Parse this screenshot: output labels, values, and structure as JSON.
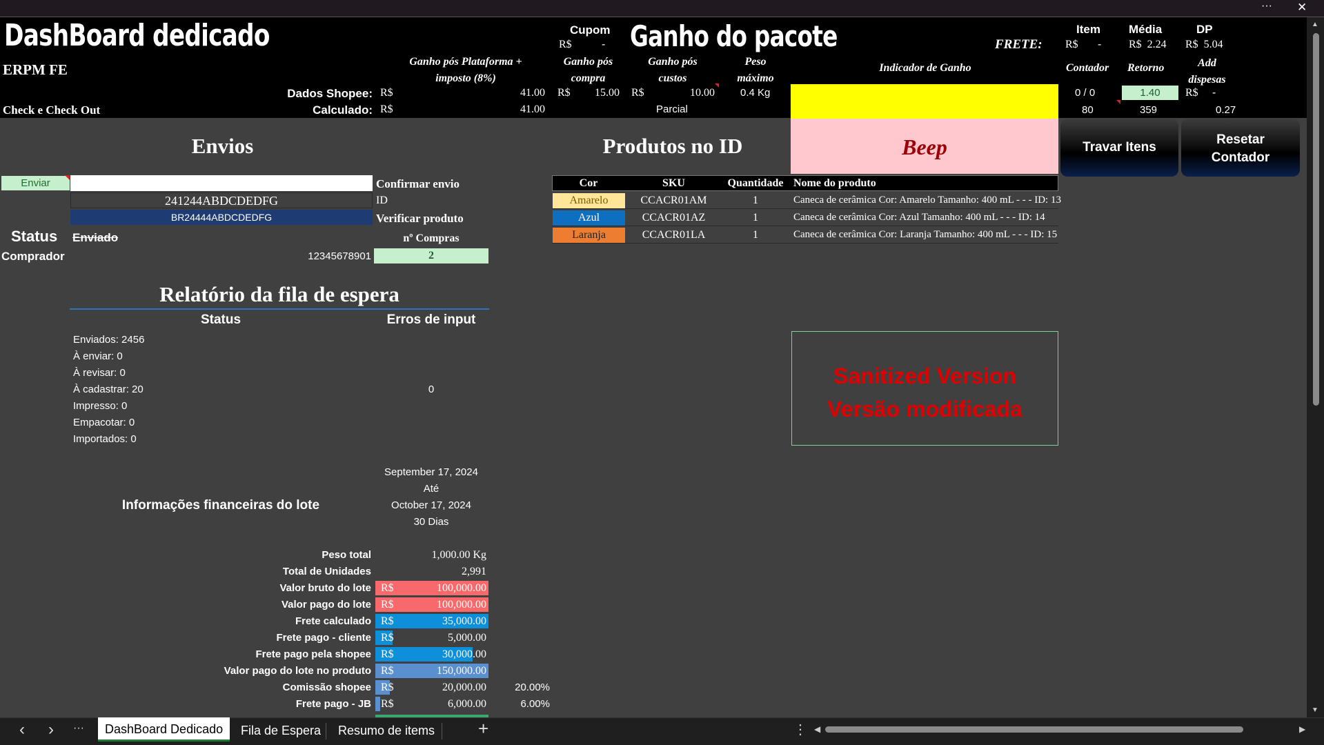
{
  "window": {
    "more": "···",
    "close": "✕"
  },
  "header": {
    "title": "DashBoard dedicado",
    "subtitle": "ERPM FE",
    "check": "Check e Check Out",
    "ganho_plataforma": "Ganho pós Plataforma + imposto (8%)",
    "ganho_plataforma_l1": "Ganho pós Plataforma +",
    "ganho_plataforma_l2": "imposto (8%)",
    "cupom": "Cupom",
    "cupom_rs": "R$",
    "cupom_dash": "-",
    "ganho_compra_l1": "Ganho pós",
    "ganho_compra_l2": "compra",
    "ganho_pacote": "Ganho do pacote",
    "ganho_custos_l1": "Ganho pós",
    "ganho_custos_l2": "custos",
    "peso_l1": "Peso",
    "peso_l2": "máximo",
    "indicador": "Indicador de Ganho",
    "frete": "FRETE:",
    "item": "Item",
    "item_rs": "R$",
    "item_dash": "-",
    "media": "Média",
    "media_val": "R$  2.24",
    "dp": "DP",
    "dp_val": "R$  5.04",
    "contador": "Contador",
    "retorno": "Retorno",
    "add_l1": "Add",
    "add_l2": "dispesas",
    "dados_label": "Dados Shopee:",
    "dados_rs": "R$",
    "dados_val": "41.00",
    "compra_rs": "R$",
    "compra_val": "15.00",
    "custos_rs": "R$",
    "custos_val": "10.00",
    "peso_val": "0.4 Kg",
    "contador_val": "0 / 0",
    "retorno_val": "1.40",
    "add_rs": "R$",
    "add_dash": "-",
    "calc_label": "Calculado:",
    "calc_rs": "R$",
    "calc_val": "41.00",
    "parcial": "Parcial",
    "contador_total": "80",
    "retorno_total": "359",
    "add_total": "0.27"
  },
  "envios": {
    "title": "Envios",
    "enviar": "Enviar",
    "confirmar": "Confirmar envio",
    "id_value": "241244ABDCDEDFG",
    "id_label": "ID",
    "product_code": "BR24444ABDCDEDFG",
    "verificar": "Verificar produto",
    "status_label": "Status",
    "status_value": "Enviado",
    "compras_label": "nº Compras",
    "comprador_label": "Comprador",
    "comprador_value": "12345678901",
    "compras_value": "2"
  },
  "produtos": {
    "title": "Produtos no ID",
    "beep": "Beep",
    "travar": "Travar Itens",
    "resetar_l1": "Resetar",
    "resetar_l2": "Contador",
    "columns": [
      "Cor",
      "SKU",
      "Quantidade",
      "Nome do produto"
    ],
    "rows": [
      {
        "cor": "Amarelo",
        "sku": "CCACR01AM",
        "qtd": "1",
        "nome": "Caneca de cerâmica Cor: Amarelo Tamanho: 400 mL - - - ID: 13",
        "color": "#ffe699",
        "text": "#7a5c00"
      },
      {
        "cor": "Azul",
        "sku": "CCACR01AZ",
        "qtd": "1",
        "nome": "Caneca de cerâmica Cor: Azul Tamanho: 400 mL - - - ID: 14",
        "color": "#0e6ebf",
        "text": "#ffffff"
      },
      {
        "cor": "Laranja",
        "sku": "CCACR01LA",
        "qtd": "1",
        "nome": "Caneca de cerâmica Cor: Laranja Tamanho: 400 mL - - - ID: 15",
        "color": "#ed7d31",
        "text": "#222222"
      }
    ]
  },
  "watermark": {
    "line1": "Sanitized Version",
    "line2": "Versão modificada"
  },
  "relatorio": {
    "title": "Relatório da fila de espera",
    "status_col": "Status",
    "erros_col": "Erros de input",
    "items": [
      "Enviados: 2456",
      "À enviar: 0",
      "À revisar: 0",
      "À cadastrar: 20",
      "Impresso: 0",
      "Empacotar: 0",
      "Importados: 0"
    ],
    "erros_value": "0"
  },
  "financeiro": {
    "title": "Informações financeiras do lote",
    "date_from": "September 17, 2024",
    "ate": "Até",
    "date_to": "October 17, 2024",
    "dias": "30 Dias",
    "rows": [
      {
        "label": "Peso total",
        "rs": "",
        "value": "1,000.00 Kg",
        "pct": "",
        "color": "",
        "fill": 0
      },
      {
        "label": "Total de Unidades",
        "rs": "",
        "value": "2,991",
        "pct": "",
        "color": "",
        "fill": 0
      },
      {
        "label": "Valor bruto do lote",
        "rs": "R$",
        "value": "100,000.00",
        "pct": "",
        "color": "#f8696b",
        "fill": 1
      },
      {
        "label": "Valor pago do lote",
        "rs": "R$",
        "value": "100,000.00",
        "pct": "",
        "color": "#f8696b",
        "fill": 1
      },
      {
        "label": "Frete calculado",
        "rs": "R$",
        "value": "35,000.00",
        "pct": "",
        "color": "#0e8fd9",
        "fill": 1
      },
      {
        "label": "Frete pago - cliente",
        "rs": "R$",
        "value": "5,000.00",
        "pct": "",
        "color": "#0e8fd9",
        "fill": 0.15
      },
      {
        "label": "Frete pago pela shopee",
        "rs": "R$",
        "value": "30,000.00",
        "pct": "",
        "color": "#0e8fd9",
        "fill": 0.86
      },
      {
        "label": "Valor pago do lote no produto",
        "rs": "R$",
        "value": "150,000.00",
        "pct": "",
        "color": "#5a8fd0",
        "fill": 1
      },
      {
        "label": "Comissão shopee",
        "rs": "R$",
        "value": "20,000.00",
        "pct": "20.00%",
        "color": "#5a8fd0",
        "fill": 0.13
      },
      {
        "label": "Frete pago - JB",
        "rs": "R$",
        "value": "6,000.00",
        "pct": "6.00%",
        "color": "#5a8fd0",
        "fill": 0.04
      }
    ]
  },
  "tabs": {
    "prev": "‹",
    "next": "›",
    "more": "···",
    "items": [
      "DashBoard Dedicado",
      "Fila de Espera",
      "Resumo de items"
    ],
    "add": "+",
    "options": "⋮",
    "hleft": "◀",
    "hright": "▶"
  },
  "colors": {
    "indicator_yellow": "#ffff00",
    "beep_bg": "#ffc7ce",
    "beep_text": "#9c0006",
    "retorno_green": "#c6efce",
    "watermark_red": "#e00000",
    "id_fill": "#1f3b73"
  }
}
